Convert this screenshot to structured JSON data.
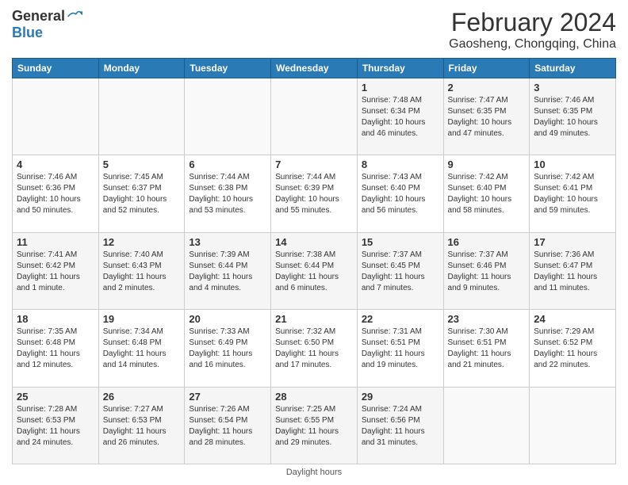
{
  "logo": {
    "general": "General",
    "blue": "Blue"
  },
  "title": "February 2024",
  "location": "Gaosheng, Chongqing, China",
  "days_of_week": [
    "Sunday",
    "Monday",
    "Tuesday",
    "Wednesday",
    "Thursday",
    "Friday",
    "Saturday"
  ],
  "weeks": [
    [
      {
        "day": "",
        "info": ""
      },
      {
        "day": "",
        "info": ""
      },
      {
        "day": "",
        "info": ""
      },
      {
        "day": "",
        "info": ""
      },
      {
        "day": "1",
        "info": "Sunrise: 7:48 AM\nSunset: 6:34 PM\nDaylight: 10 hours\nand 46 minutes."
      },
      {
        "day": "2",
        "info": "Sunrise: 7:47 AM\nSunset: 6:35 PM\nDaylight: 10 hours\nand 47 minutes."
      },
      {
        "day": "3",
        "info": "Sunrise: 7:46 AM\nSunset: 6:35 PM\nDaylight: 10 hours\nand 49 minutes."
      }
    ],
    [
      {
        "day": "4",
        "info": "Sunrise: 7:46 AM\nSunset: 6:36 PM\nDaylight: 10 hours\nand 50 minutes."
      },
      {
        "day": "5",
        "info": "Sunrise: 7:45 AM\nSunset: 6:37 PM\nDaylight: 10 hours\nand 52 minutes."
      },
      {
        "day": "6",
        "info": "Sunrise: 7:44 AM\nSunset: 6:38 PM\nDaylight: 10 hours\nand 53 minutes."
      },
      {
        "day": "7",
        "info": "Sunrise: 7:44 AM\nSunset: 6:39 PM\nDaylight: 10 hours\nand 55 minutes."
      },
      {
        "day": "8",
        "info": "Sunrise: 7:43 AM\nSunset: 6:40 PM\nDaylight: 10 hours\nand 56 minutes."
      },
      {
        "day": "9",
        "info": "Sunrise: 7:42 AM\nSunset: 6:40 PM\nDaylight: 10 hours\nand 58 minutes."
      },
      {
        "day": "10",
        "info": "Sunrise: 7:42 AM\nSunset: 6:41 PM\nDaylight: 10 hours\nand 59 minutes."
      }
    ],
    [
      {
        "day": "11",
        "info": "Sunrise: 7:41 AM\nSunset: 6:42 PM\nDaylight: 11 hours\nand 1 minute."
      },
      {
        "day": "12",
        "info": "Sunrise: 7:40 AM\nSunset: 6:43 PM\nDaylight: 11 hours\nand 2 minutes."
      },
      {
        "day": "13",
        "info": "Sunrise: 7:39 AM\nSunset: 6:44 PM\nDaylight: 11 hours\nand 4 minutes."
      },
      {
        "day": "14",
        "info": "Sunrise: 7:38 AM\nSunset: 6:44 PM\nDaylight: 11 hours\nand 6 minutes."
      },
      {
        "day": "15",
        "info": "Sunrise: 7:37 AM\nSunset: 6:45 PM\nDaylight: 11 hours\nand 7 minutes."
      },
      {
        "day": "16",
        "info": "Sunrise: 7:37 AM\nSunset: 6:46 PM\nDaylight: 11 hours\nand 9 minutes."
      },
      {
        "day": "17",
        "info": "Sunrise: 7:36 AM\nSunset: 6:47 PM\nDaylight: 11 hours\nand 11 minutes."
      }
    ],
    [
      {
        "day": "18",
        "info": "Sunrise: 7:35 AM\nSunset: 6:48 PM\nDaylight: 11 hours\nand 12 minutes."
      },
      {
        "day": "19",
        "info": "Sunrise: 7:34 AM\nSunset: 6:48 PM\nDaylight: 11 hours\nand 14 minutes."
      },
      {
        "day": "20",
        "info": "Sunrise: 7:33 AM\nSunset: 6:49 PM\nDaylight: 11 hours\nand 16 minutes."
      },
      {
        "day": "21",
        "info": "Sunrise: 7:32 AM\nSunset: 6:50 PM\nDaylight: 11 hours\nand 17 minutes."
      },
      {
        "day": "22",
        "info": "Sunrise: 7:31 AM\nSunset: 6:51 PM\nDaylight: 11 hours\nand 19 minutes."
      },
      {
        "day": "23",
        "info": "Sunrise: 7:30 AM\nSunset: 6:51 PM\nDaylight: 11 hours\nand 21 minutes."
      },
      {
        "day": "24",
        "info": "Sunrise: 7:29 AM\nSunset: 6:52 PM\nDaylight: 11 hours\nand 22 minutes."
      }
    ],
    [
      {
        "day": "25",
        "info": "Sunrise: 7:28 AM\nSunset: 6:53 PM\nDaylight: 11 hours\nand 24 minutes."
      },
      {
        "day": "26",
        "info": "Sunrise: 7:27 AM\nSunset: 6:53 PM\nDaylight: 11 hours\nand 26 minutes."
      },
      {
        "day": "27",
        "info": "Sunrise: 7:26 AM\nSunset: 6:54 PM\nDaylight: 11 hours\nand 28 minutes."
      },
      {
        "day": "28",
        "info": "Sunrise: 7:25 AM\nSunset: 6:55 PM\nDaylight: 11 hours\nand 29 minutes."
      },
      {
        "day": "29",
        "info": "Sunrise: 7:24 AM\nSunset: 6:56 PM\nDaylight: 11 hours\nand 31 minutes."
      },
      {
        "day": "",
        "info": ""
      },
      {
        "day": "",
        "info": ""
      }
    ]
  ],
  "footer": "Daylight hours"
}
